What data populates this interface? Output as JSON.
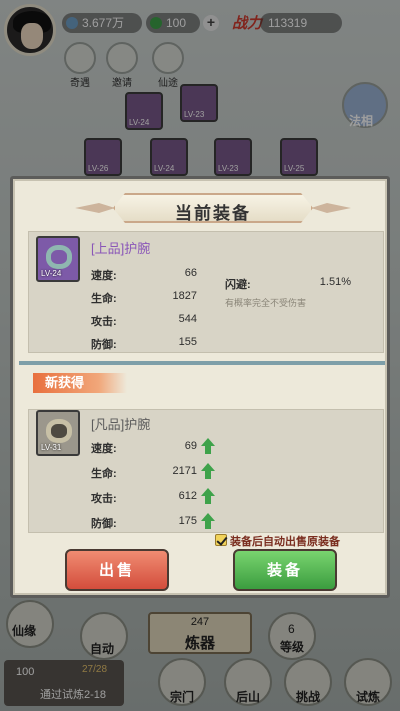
{
  "player": {
    "currency_amount": "3.677万",
    "gem_amount": "100",
    "power_logo": "战力",
    "power_value": "113319"
  },
  "top_menu": [
    {
      "label": "奇遇",
      "icon": "scroll-icon"
    },
    {
      "label": "邀请",
      "icon": "invite-icon"
    },
    {
      "label": "仙途",
      "icon": "path-icon"
    }
  ],
  "side": {
    "faxiang_label": "法相"
  },
  "equipment_slots": [
    {
      "lv": "LV-24"
    },
    {
      "lv": "LV-23"
    },
    {
      "lv": "LV-26"
    },
    {
      "lv": "LV-24"
    },
    {
      "lv": "LV-23"
    },
    {
      "lv": "LV-25"
    }
  ],
  "dialog": {
    "title": "当前装备",
    "current": {
      "name": "[上品]护腕",
      "lv": "LV-24",
      "stats": [
        {
          "label": "速度:",
          "value": "66"
        },
        {
          "label": "生命:",
          "value": "1827"
        },
        {
          "label": "攻击:",
          "value": "544"
        },
        {
          "label": "防御:",
          "value": "155"
        }
      ],
      "dodge_label": "闪避:",
      "dodge_value": "1.51%",
      "dodge_desc": "有概率完全不受伤害"
    },
    "new_tag": "新获得",
    "new_item": {
      "name": "[凡品]护腕",
      "lv": "LV-31",
      "stats": [
        {
          "label": "速度:",
          "value": "69"
        },
        {
          "label": "生命:",
          "value": "2171"
        },
        {
          "label": "攻击:",
          "value": "612"
        },
        {
          "label": "防御:",
          "value": "175"
        }
      ]
    },
    "auto_sell_label": "装备后自动出售原装备",
    "sell_button": "出售",
    "equip_button": "装备"
  },
  "bottom": {
    "xianyuan": "仙缘",
    "auto": "自动",
    "refine_count": "247",
    "refine_label": "炼器",
    "level_num": "6",
    "level_label": "等级",
    "trial_count": "100",
    "trial_progress": "27/28",
    "trial_text": "通过试炼2-18",
    "zongmen": "宗门",
    "houshan": "后山",
    "tiaozhan": "挑战",
    "shilian": "试炼"
  },
  "colors": {
    "premium_name": "#8a56b8",
    "common_name": "#5c5c5c",
    "arrow_green": "#3ea24a",
    "sell_red": "#d34d3c",
    "equip_green": "#3b9d3f"
  }
}
